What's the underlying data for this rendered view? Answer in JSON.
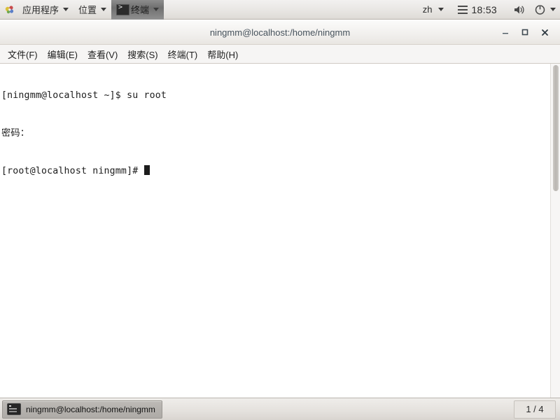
{
  "top_panel": {
    "logo_icon": "distro-logo-icon",
    "items": [
      {
        "label": "应用程序",
        "icon": "applications-menu-icon",
        "has_caret": true
      },
      {
        "label": "位置",
        "icon": "places-menu-icon",
        "has_caret": true
      },
      {
        "label": "终端",
        "icon": "terminal-window-icon",
        "has_caret": true,
        "active": true
      }
    ],
    "status": {
      "input_method": "zh",
      "calendar_icon": "hamburger-calendar-icon",
      "clock": "18:53",
      "volume_icon": "volume-speaker-icon",
      "power_icon": "power-button-icon",
      "power_caret": true
    }
  },
  "window": {
    "title": "ningmm@localhost:/home/ningmm",
    "buttons": {
      "minimize": "−",
      "maximize": "□",
      "close": "✕"
    },
    "menus": [
      {
        "label": "文件(F)"
      },
      {
        "label": "编辑(E)"
      },
      {
        "label": "查看(V)"
      },
      {
        "label": "搜索(S)"
      },
      {
        "label": "终端(T)"
      },
      {
        "label": "帮助(H)"
      }
    ],
    "terminal": {
      "lines": [
        "[ningmm@localhost ~]$ su root",
        "密码：",
        "[root@localhost ningmm]# "
      ],
      "cursor_visible": true,
      "background_color": "#ffffff",
      "text_color": "#1c1c1c"
    }
  },
  "bottom_panel": {
    "task_items": [
      {
        "label": "ningmm@localhost:/home/ningmm",
        "icon": "terminal-window-icon",
        "active": true
      }
    ],
    "workspace_indicator": "1 / 4"
  }
}
